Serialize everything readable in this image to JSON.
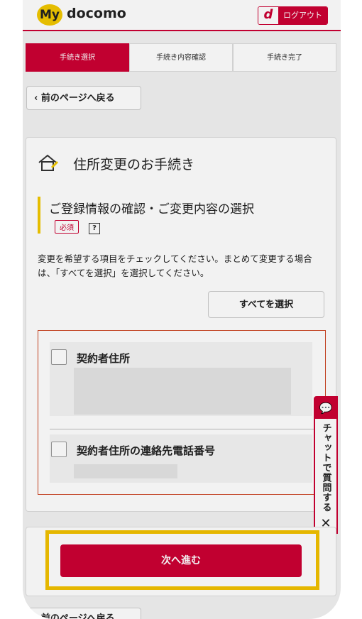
{
  "header": {
    "logo_my": "My",
    "logo_text": "docomo",
    "logout_d": "d",
    "logout_label": "ログアウト"
  },
  "steps": [
    {
      "label": "手続き選択",
      "active": true
    },
    {
      "label": "手続き内容確認",
      "active": false
    },
    {
      "label": "手続き完了",
      "active": false
    }
  ],
  "back_button": {
    "label": "前のページへ戻る"
  },
  "main": {
    "title": "住所変更のお手続き",
    "section_title": "ご登録情報の確認・ご変更内容の選択",
    "required_badge": "必須",
    "help_icon": "?",
    "description": "変更を希望する項目をチェックしてください。まとめて変更する場合は、「すべてを選択」を選択してください。",
    "select_all_label": "すべてを選択",
    "options": [
      {
        "label": "契約者住所",
        "checked": false
      },
      {
        "label": "契約者住所の連絡先電話番号",
        "checked": false
      }
    ]
  },
  "chat_tab": {
    "label": "チャットで質問する",
    "close": "✕"
  },
  "next_button": {
    "label": "次へ進む"
  },
  "colors": {
    "brand": "#cc0033",
    "accent": "#f2c800"
  }
}
